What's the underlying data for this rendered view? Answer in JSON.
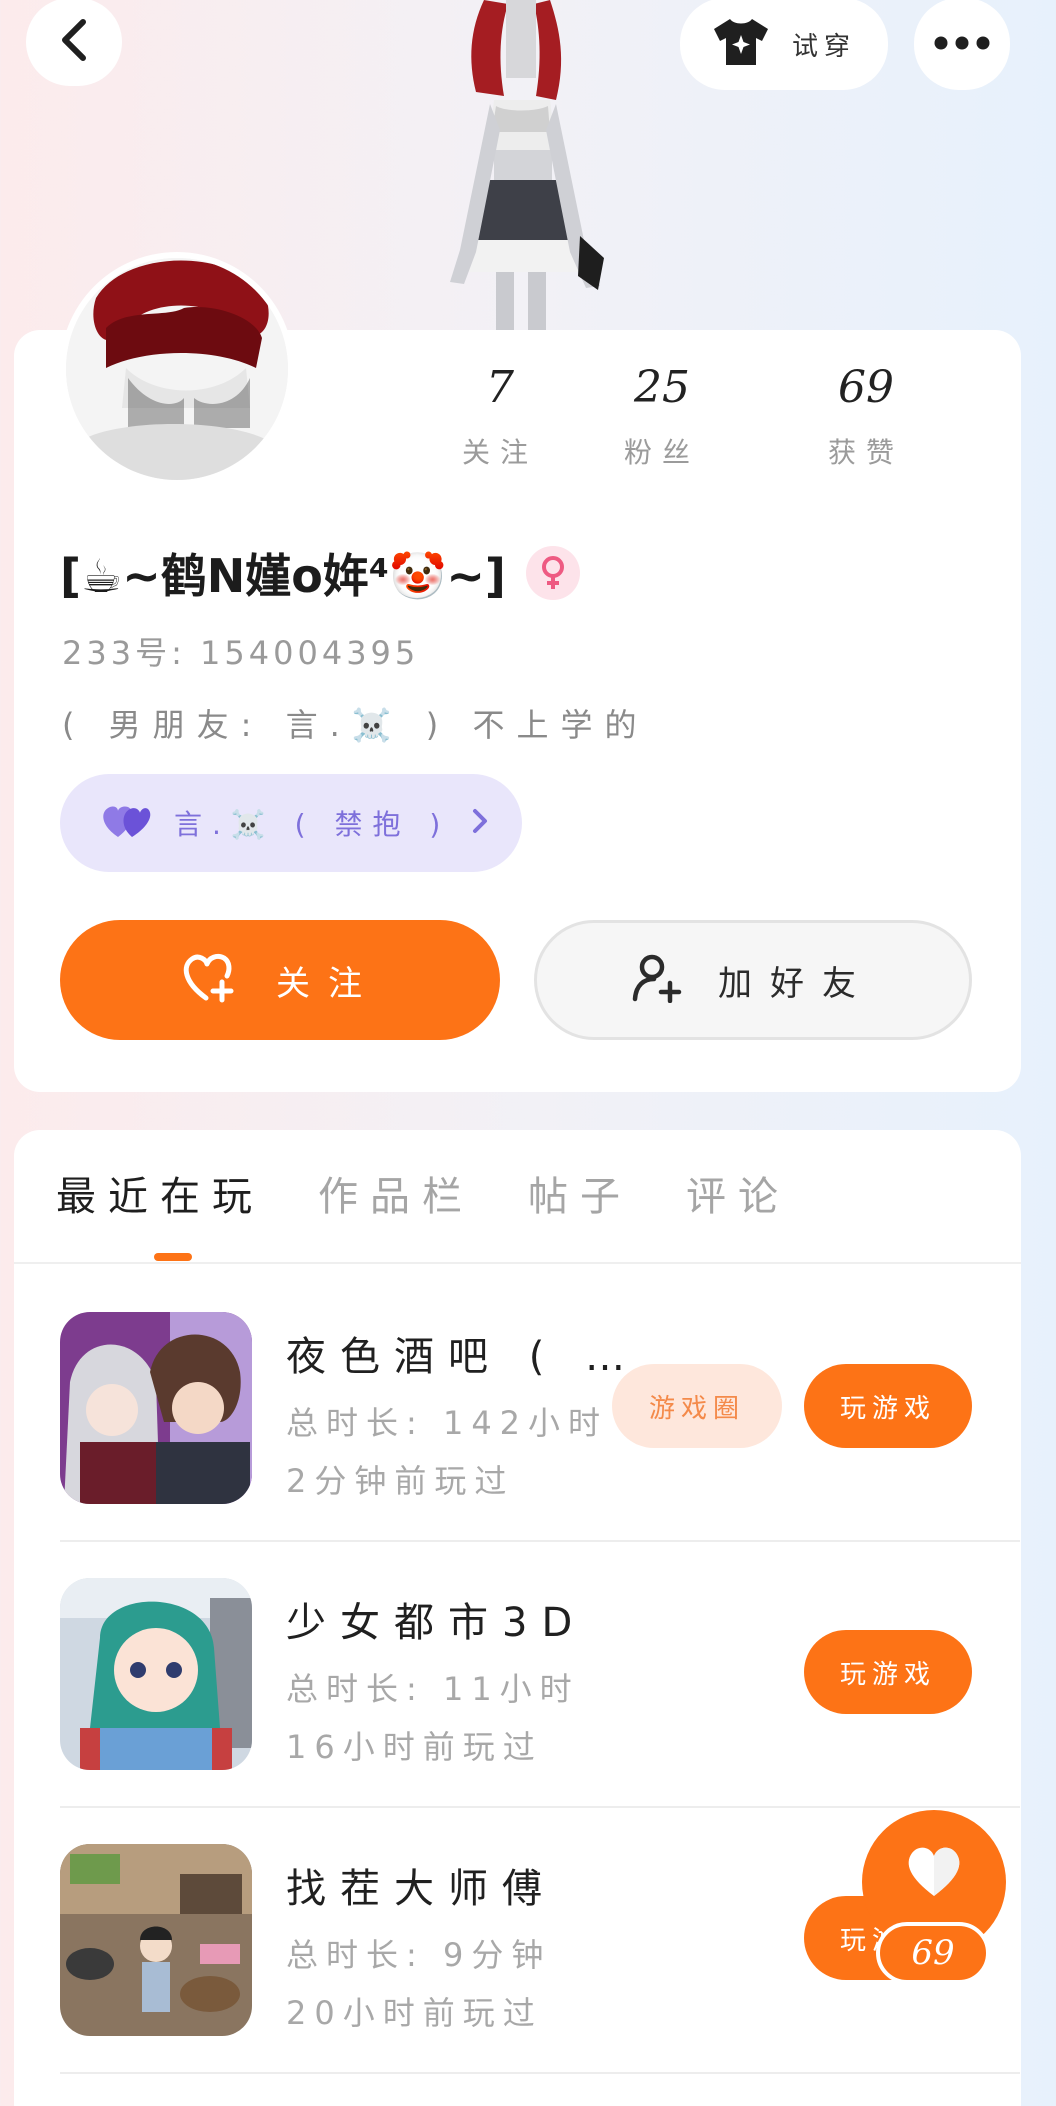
{
  "top_bar": {
    "try_on_label": "试穿"
  },
  "stats": {
    "following": {
      "value": "7",
      "label": "关注"
    },
    "fans": {
      "value": "25",
      "label": "粉丝"
    },
    "likes": {
      "value": "69",
      "label": "获赞"
    }
  },
  "profile": {
    "nickname": "[☕~鹤N嫤o姩⁴🤡~]",
    "uid": "233号: 154004395",
    "bio": "( 男朋友: 言.☠️ ) 不上学的",
    "cp_label": "言.☠️ ( 禁抱 )"
  },
  "actions": {
    "follow_label": "关注",
    "add_friend_label": "加好友"
  },
  "tabs": [
    {
      "label": "最近在玩"
    },
    {
      "label": "作品栏"
    },
    {
      "label": "帖子"
    },
    {
      "label": "评论"
    }
  ],
  "games": [
    {
      "title": "夜色酒吧 ( …",
      "duration": "总时长: 142小时",
      "last_played": "2分钟前玩过",
      "circle_label": "游戏圈",
      "play_label": "玩游戏"
    },
    {
      "title": "少女都市3D",
      "duration": "总时长: 11小时",
      "last_played": "16小时前玩过",
      "play_label": "玩游戏"
    },
    {
      "title": "找茬大师傅",
      "duration": "总时长: 9分钟",
      "last_played": "20小时前玩过",
      "play_label": "玩游戏"
    }
  ],
  "fab": {
    "like_count": "69"
  },
  "colors": {
    "accent": "#fd7316",
    "accent_light": "#fee7dc",
    "cp_bg": "#e9e6fb",
    "cp_text": "#7e70db"
  }
}
